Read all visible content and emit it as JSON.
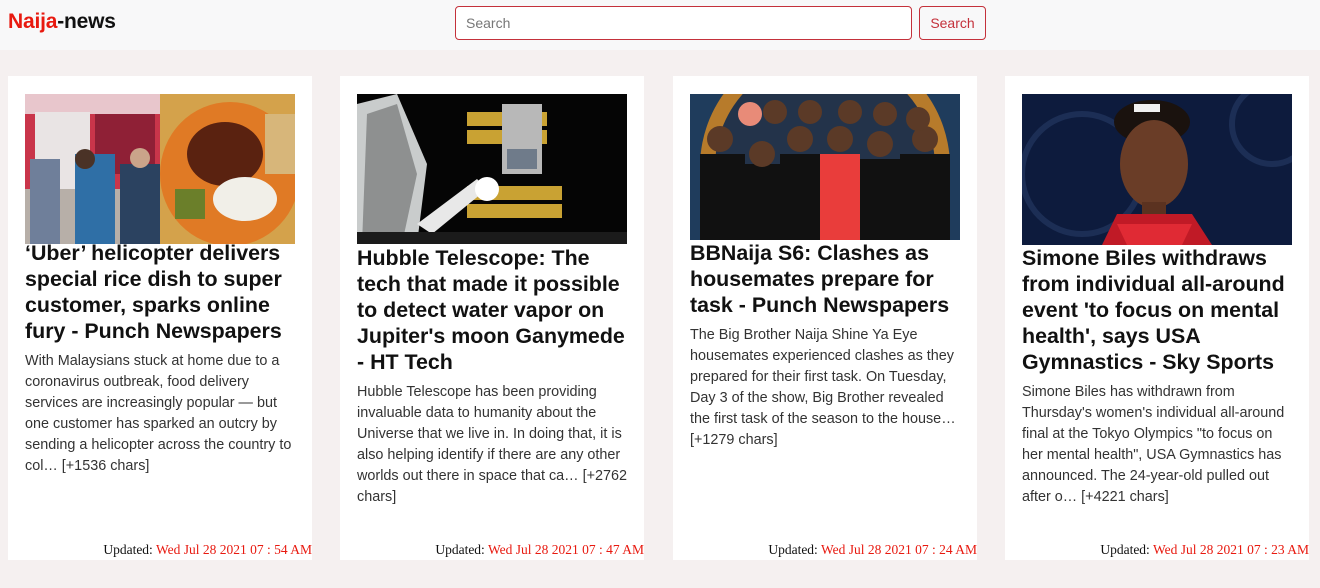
{
  "brand": {
    "part1": "Naija",
    "part2": "-news"
  },
  "search": {
    "placeholder": "Search",
    "button_label": "Search"
  },
  "articles": [
    {
      "title": "‘Uber’ helicopter delivers special rice dish to super customer, sparks online fury - Punch Newspapers",
      "description": "With Malaysians stuck at home due to a coronavirus outbreak, food delivery services are increasingly popular — but one customer has sparked an outcry by sending a helicopter across the country to col… [+1536 chars]",
      "updated_label": "Updated: ",
      "updated_value": "Wed Jul 28 2021 07 : 54 AM"
    },
    {
      "title": "Hubble Telescope: The tech that made it possible to detect water vapor on Jupiter's moon Ganymede - HT Tech",
      "description": "Hubble Telescope has been providing invaluable data to humanity about the Universe that we live in. In doing that, it is also helping identify if there are any other worlds out there in space that ca… [+2762 chars]",
      "updated_label": "Updated: ",
      "updated_value": "Wed Jul 28 2021 07 : 47 AM"
    },
    {
      "title": "BBNaija S6: Clashes as housemates prepare for task - Punch Newspapers",
      "description": "The Big Brother Naija Shine Ya Eye housemates experienced clashes as they prepared for their first task. On Tuesday, Day 3 of the show, Big Brother revealed the first task of the season to the house… [+1279 chars]",
      "updated_label": "Updated: ",
      "updated_value": "Wed Jul 28 2021 07 : 24 AM"
    },
    {
      "title": "Simone Biles withdraws from individual all-around event 'to focus on mental health', says USA Gymnastics - Sky Sports",
      "description": "Simone Biles has withdrawn from Thursday's women's individual all-around final at the Tokyo Olympics \"to focus on her mental health\", USA Gymnastics has announced. The 24-year-old pulled out after o… [+4221 chars]",
      "updated_label": "Updated: ",
      "updated_value": "Wed Jul 28 2021 07 : 23 AM"
    }
  ],
  "colors": {
    "brand_red": "#e8190f",
    "search_border": "#c4313b",
    "page_bg": "#f5f0f0"
  }
}
